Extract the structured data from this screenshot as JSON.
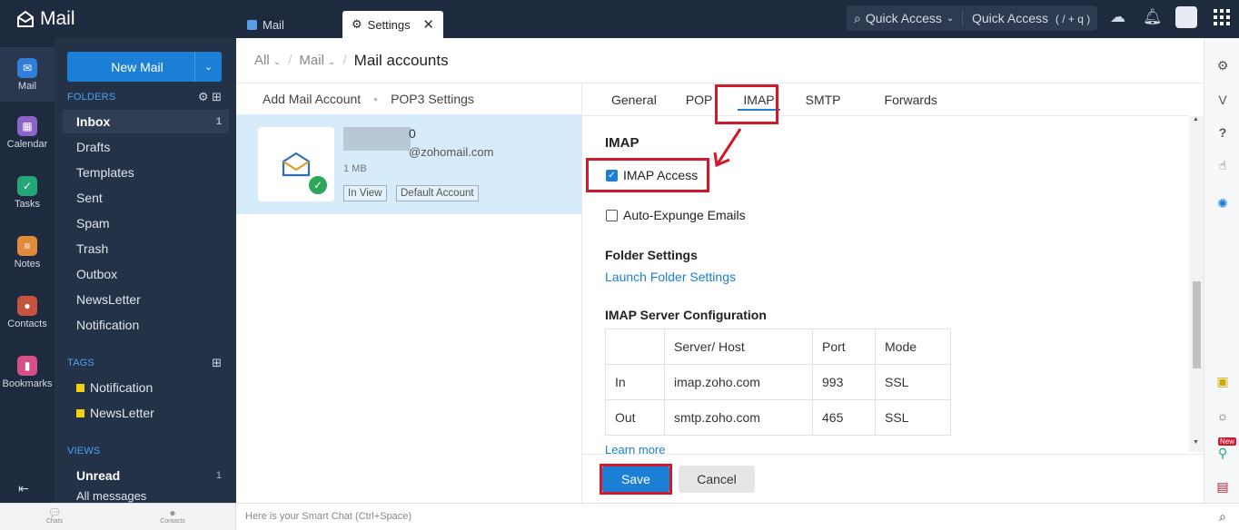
{
  "app": {
    "name": "Mail"
  },
  "tabs": [
    {
      "label": "Mail"
    },
    {
      "label": "Settings"
    }
  ],
  "topbar": {
    "quick_access_1": "Quick Access",
    "quick_access_2": "Quick Access",
    "shortcut": "( / + q )"
  },
  "rail": [
    {
      "label": "Mail",
      "color": "#2f7fd8"
    },
    {
      "label": "Calendar",
      "color": "#8c63c9"
    },
    {
      "label": "Tasks",
      "color": "#23a776"
    },
    {
      "label": "Notes",
      "color": "#e08a3c"
    },
    {
      "label": "Contacts",
      "color": "#c4543f"
    },
    {
      "label": "Bookmarks",
      "color": "#d64f86"
    }
  ],
  "folders_panel": {
    "new_mail": "New Mail",
    "folders_heading": "FOLDERS",
    "folders": [
      {
        "label": "Inbox",
        "count": "1"
      },
      {
        "label": "Drafts"
      },
      {
        "label": "Templates"
      },
      {
        "label": "Sent"
      },
      {
        "label": "Spam"
      },
      {
        "label": "Trash"
      },
      {
        "label": "Outbox"
      },
      {
        "label": "NewsLetter"
      },
      {
        "label": "Notification"
      }
    ],
    "tags_heading": "TAGS",
    "tags": [
      {
        "label": "Notification"
      },
      {
        "label": "NewsLetter"
      }
    ],
    "views_heading": "VIEWS",
    "views": [
      {
        "label": "Unread",
        "count": "1"
      },
      {
        "label": "All messages"
      }
    ]
  },
  "breadcrumb": {
    "item1": "All",
    "item2": "Mail",
    "current": "Mail accounts"
  },
  "accounts": {
    "add_link": "Add Mail Account",
    "pop3_link": "POP3 Settings",
    "card": {
      "name_suffix": "0",
      "email": "@zohomail.com",
      "size": "1 MB",
      "badge1": "In View",
      "badge2": "Default Account"
    }
  },
  "settings_tabs": [
    {
      "label": "General"
    },
    {
      "label": "POP"
    },
    {
      "label": "IMAP"
    },
    {
      "label": "SMTP"
    },
    {
      "label": "Forwards"
    }
  ],
  "imap": {
    "heading": "IMAP",
    "imap_access": "IMAP Access",
    "auto_expunge": "Auto-Expunge Emails",
    "folder_settings_heading": "Folder Settings",
    "folder_settings_link": "Launch Folder Settings",
    "server_config_heading": "IMAP Server Configuration",
    "table": {
      "headers": [
        "",
        "Server/ Host",
        "Port",
        "Mode"
      ],
      "rows": [
        [
          "In",
          "imap.zoho.com",
          "993",
          "SSL"
        ],
        [
          "Out",
          "smtp.zoho.com",
          "465",
          "SSL"
        ]
      ]
    },
    "learn_more": "Learn more"
  },
  "actions": {
    "save": "Save",
    "cancel": "Cancel"
  },
  "bottombar": {
    "chats": "Chats",
    "contacts": "Contacts",
    "smart_chat_placeholder": "Here is your Smart Chat (Ctrl+Space)"
  },
  "right_rail": {
    "new_badge": "New"
  },
  "colors": {
    "accent": "#1b7fd6",
    "highlight_red": "#d4182b",
    "sidebar": "#243247",
    "topbar": "#1e2a3d"
  }
}
